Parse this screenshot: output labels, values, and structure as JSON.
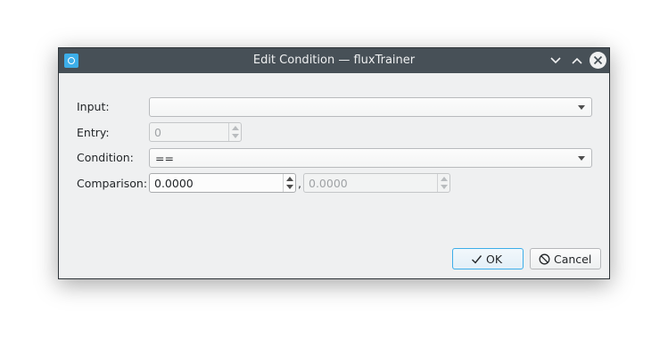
{
  "window": {
    "title": "Edit Condition — fluxTrainer"
  },
  "form": {
    "input_label": "Input:",
    "input_value": "",
    "entry_label": "Entry:",
    "entry_value": "0",
    "condition_label": "Condition:",
    "condition_value": "==",
    "comparison_label": "Comparison:",
    "comparison_value": "0.0000",
    "comparison_separator": ",",
    "comparison_value2": "0.0000"
  },
  "buttons": {
    "ok_label": "OK",
    "cancel_label": "Cancel"
  },
  "icons": {
    "app": "app-icon",
    "minimize": "chevron-down-icon",
    "maximize": "chevron-up-icon",
    "close": "close-icon",
    "ok": "checkmark-icon",
    "cancel": "cancel-circle-icon"
  },
  "colors": {
    "titlebar": "#475057",
    "window_bg": "#eff0f1",
    "accent": "#3daee9"
  }
}
